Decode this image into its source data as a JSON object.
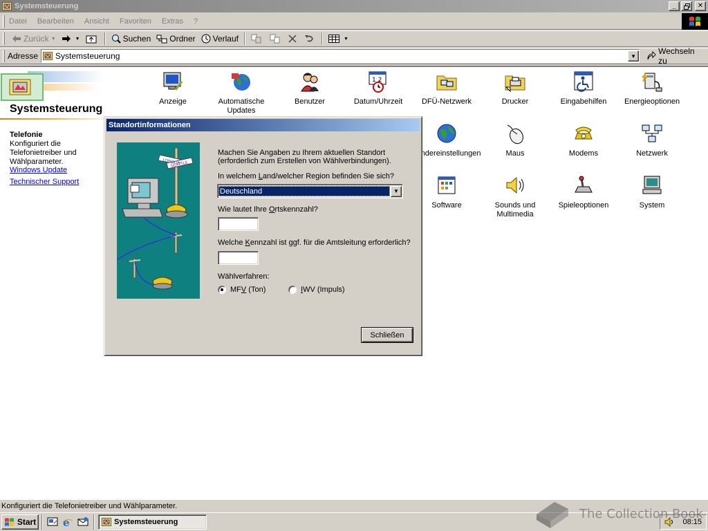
{
  "window": {
    "title": "Systemsteuerung"
  },
  "menu": {
    "items": [
      {
        "label": "Datei"
      },
      {
        "label": "Bearbeiten"
      },
      {
        "label": "Ansicht"
      },
      {
        "label": "Favoriten"
      },
      {
        "label": "Extras"
      },
      {
        "label": "?"
      }
    ]
  },
  "toolbar": {
    "back_label": "Zurück",
    "search_label": "Suchen",
    "folders_label": "Ordner",
    "history_label": "Verlauf"
  },
  "address": {
    "label": "Adresse",
    "value": "Systemsteuerung",
    "go_label": "Wechseln zu"
  },
  "leftpane": {
    "title": "Systemsteuerung",
    "selected_name": "Telefonie",
    "selected_desc": "Konfiguriert die Telefonietreiber und Wählparameter.",
    "links": [
      "Windows Update",
      "Technischer Support"
    ]
  },
  "icons": [
    {
      "label": "Anzeige"
    },
    {
      "label": "Automatische Updates"
    },
    {
      "label": "Benutzer"
    },
    {
      "label": "Datum/Uhrzeit"
    },
    {
      "label": "DFÜ-Netzwerk"
    },
    {
      "label": "Drucker"
    },
    {
      "label": "Eingabehilfen"
    },
    {
      "label": "Energieoptionen"
    },
    {
      "label": "Ländereinstellungen"
    },
    {
      "label": "Maus"
    },
    {
      "label": "Modems"
    },
    {
      "label": "Netzwerk"
    },
    {
      "label": "Software"
    },
    {
      "label": "Sounds und Multimedia"
    },
    {
      "label": "Spieleoptionen"
    },
    {
      "label": "System"
    }
  ],
  "dialog": {
    "title": "Standortinformationen",
    "intro_line1": "Machen Sie Angaben zu Ihrem aktuellen Standort",
    "intro_line2": "(erforderlich zum Erstellen von Wählverbindungen).",
    "country_question_pre": "In welchem ",
    "country_question_ul": "L",
    "country_question_post": "and/welcher Region befinden Sie sich?",
    "country_value": "Deutschland",
    "area_code_pre": "Wie lautet Ihre ",
    "area_code_ul": "O",
    "area_code_post": "rtskennzahl?",
    "area_code_value": "",
    "outside_line_pre": "Welche ",
    "outside_line_ul": "K",
    "outside_line_post": "ennzahl ist ggf. für die Amtsleitung erforderlich?",
    "outside_line_value": "",
    "dial_method_label": "Wählverfahren:",
    "tone_pre": "MF",
    "tone_ul": "V",
    "tone_post": " (Ton)",
    "pulse_ul": "I",
    "pulse_post": "WV (Impuls)",
    "dial_method_selected": "tone",
    "close_label": "Schließen",
    "sign_text_1": "LONDON",
    "sign_text_2": "SEATTLE"
  },
  "statusbar": {
    "text": "Konfiguriert die Telefonietreiber und Wählparameter."
  },
  "taskbar": {
    "start_label": "Start",
    "task_label": "Systemsteuerung",
    "clock": "08:15"
  },
  "watermark": {
    "text": "The Collection Book"
  },
  "colors": {
    "dialog_title_start": "#0a246a",
    "dialog_title_end": "#a6caf0",
    "link": "#0000ee",
    "illustration_bg": "#0f8080"
  }
}
